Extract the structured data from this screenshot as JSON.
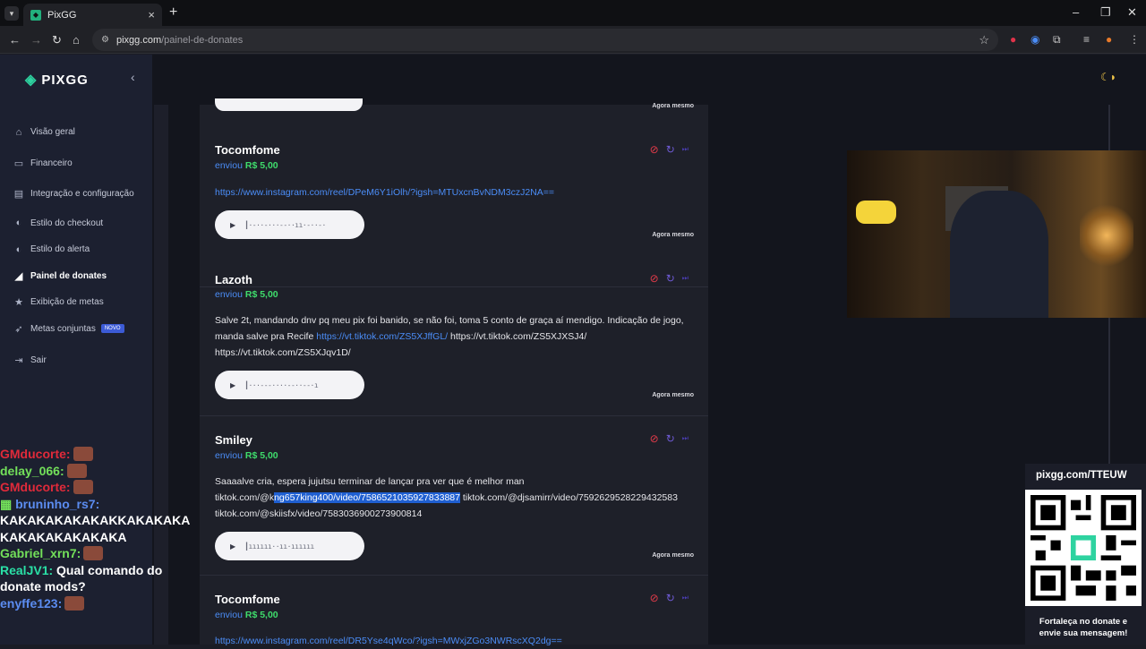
{
  "browser": {
    "tab_title": "PixGG",
    "url_domain": "pixgg.com",
    "url_path": "/painel-de-donates"
  },
  "sidebar": {
    "brand": "PIXGG",
    "items": [
      {
        "label": "Visão geral",
        "icon": "home-icon"
      },
      {
        "label": "Financeiro",
        "icon": "wallet-icon"
      },
      {
        "label": "Integração e configuração",
        "icon": "settings-icon"
      },
      {
        "label": "Estilo do checkout",
        "icon": "palette-icon"
      },
      {
        "label": "Estilo do alerta",
        "icon": "palette-icon"
      },
      {
        "label": "Painel de donates",
        "icon": "broadcast-icon"
      },
      {
        "label": "Exibição de metas",
        "icon": "star-icon"
      },
      {
        "label": "Metas conjuntas",
        "icon": "rocket-icon",
        "badge": "NOVO"
      },
      {
        "label": "Sair",
        "icon": "logout-icon"
      }
    ]
  },
  "donations": [
    {
      "name": "Tocomfome",
      "sent_prefix": "enviou",
      "amount": "R$ 5,00",
      "message_link": "https://www.instagram.com/reel/DPeM6Y1iOlh/?igsh=MTUxcnBvNDM3czJ2NA==",
      "time": "Agora mesmo"
    },
    {
      "name": "Lazoth",
      "sent_prefix": "enviou",
      "amount": "R$ 5,00",
      "msg_a": "Salve 2t, mandando dnv pq meu pix foi banido, se não foi, toma 5 conto de graça aí mendigo. Indicação de jogo, manda salve pra Recife ",
      "msg_link": "https://vt.tiktok.com/ZS5XJffGL/",
      "msg_b": " https://vt.tiktok.com/ZS5XJXSJ4/ https://vt.tiktok.com/ZS5XJqv1D/",
      "time": "Agora mesmo"
    },
    {
      "name": "Smiley",
      "sent_prefix": "enviou",
      "amount": "R$ 5,00",
      "msg_a": "Saaaalve cria, espera jujutsu terminar de lançar pra ver que é melhor man tiktok.com/@k",
      "msg_hl": "ng657king400/video/7586521035927833887",
      "msg_b": " tiktok.com/@djsamirr/video/7592629528229432583 tiktok.com/@skiisfx/video/7583036900273900814",
      "time": "Agora mesmo"
    },
    {
      "name": "Tocomfome",
      "sent_prefix": "enviou",
      "amount": "R$ 5,00",
      "message_link": "https://www.instagram.com/reel/DR5Yse4qWco/?igsh=MWxjZGo3NWRscXQ2dg==",
      "time": ""
    }
  ],
  "top_time": "Agora mesmo",
  "qr": {
    "title": "pixgg.com/TTEUW",
    "footer_1": "Fortaleça no donate e",
    "footer_2": "envie sua mensagem!"
  },
  "chat": [
    {
      "user": "GMducorte:",
      "text": "",
      "color": "#e02a3a"
    },
    {
      "user": "delay_066:",
      "text": "",
      "color": "#73e05a"
    },
    {
      "user": "GMducorte:",
      "text": "",
      "color": "#e02a3a"
    },
    {
      "user": "bruninho_rs7:",
      "text": "KAKAKAKAKAKAKKAKAKAKA KAKAKAKAKAKAKA",
      "color": "#5b8cf0"
    },
    {
      "user": "Gabriel_xrn7:",
      "text": "",
      "color": "#73e05a"
    },
    {
      "user": "RealJV1:",
      "text": "Qual comando do donate mods?",
      "color": "#2ae0a6"
    },
    {
      "user": "enyffe123:",
      "text": "",
      "color": "#5b8cf0"
    }
  ]
}
